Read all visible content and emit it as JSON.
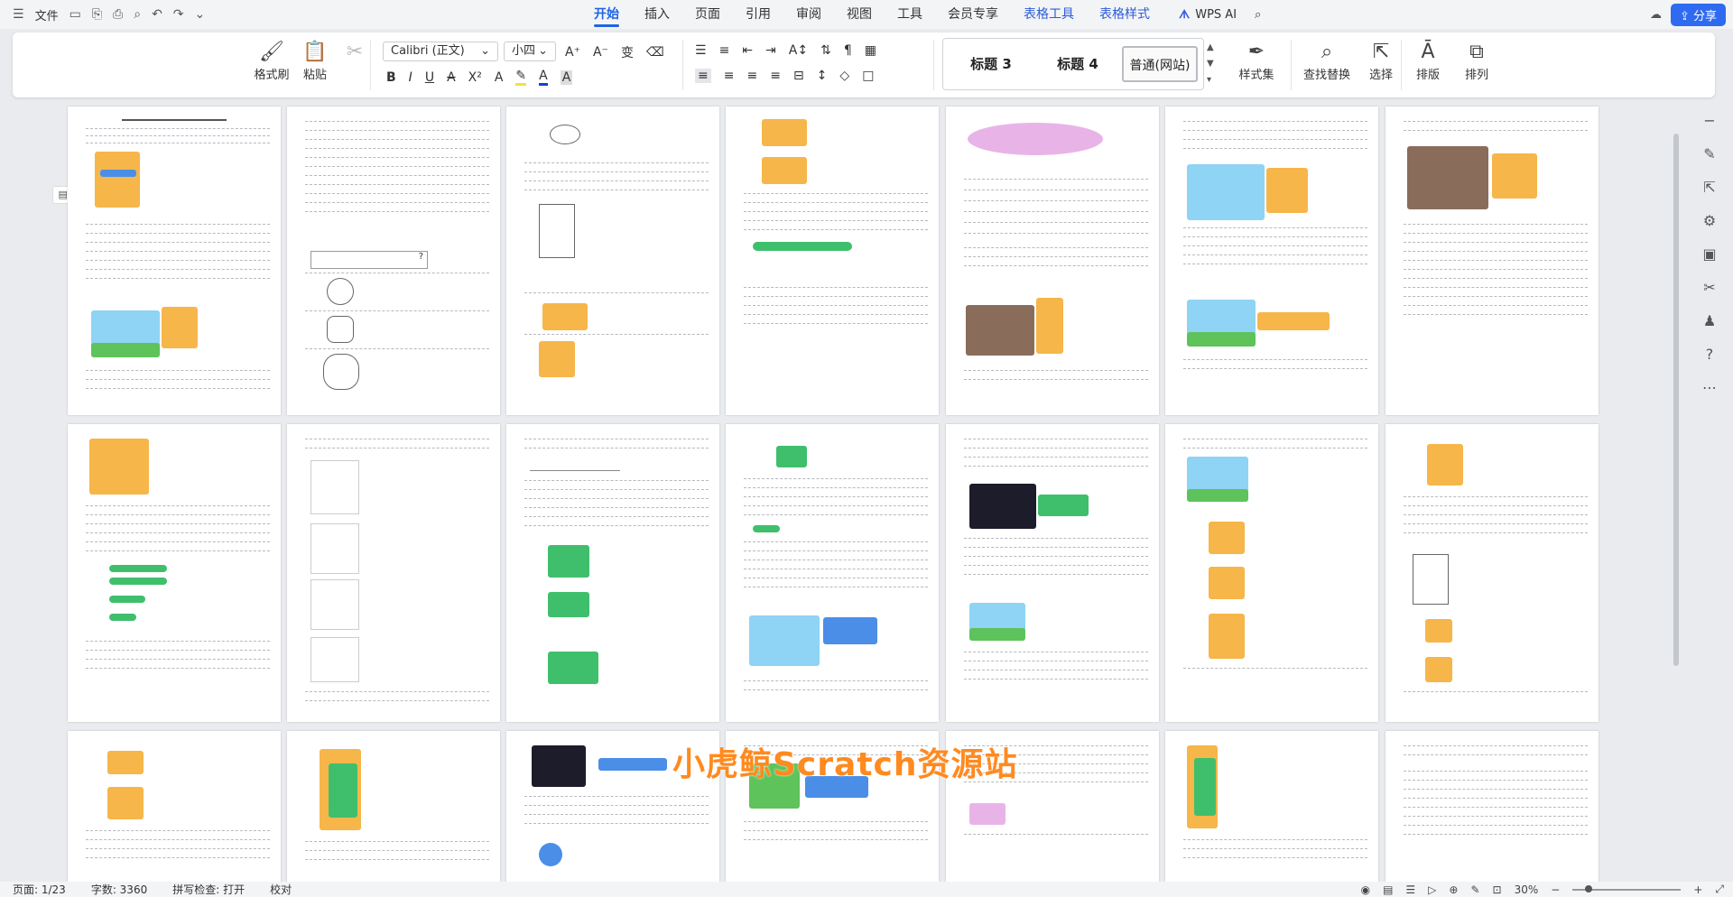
{
  "topbar": {
    "file_menu": "文件",
    "tabs": [
      "开始",
      "插入",
      "页面",
      "引用",
      "审阅",
      "视图",
      "工具",
      "会员专享",
      "表格工具",
      "表格样式"
    ],
    "wps_ai": "WPS AI",
    "share": "分享"
  },
  "ribbon": {
    "format_painter": "格式刷",
    "paste": "粘贴",
    "font_name": "Calibri (正文)",
    "font_size": "小四",
    "styles": [
      "标题 3",
      "标题 4",
      "普通(网站)"
    ],
    "style_set": "样式集",
    "find_replace": "查找替换",
    "select": "选择",
    "typesetting": "排版",
    "arrange": "排列"
  },
  "watermark": "小虎鲸Scratch资源站",
  "statusbar": {
    "page": "页面: 1/23",
    "words": "字数: 3360",
    "spell": "拼写检查: 打开",
    "proof": "校对",
    "zoom": "30%"
  }
}
